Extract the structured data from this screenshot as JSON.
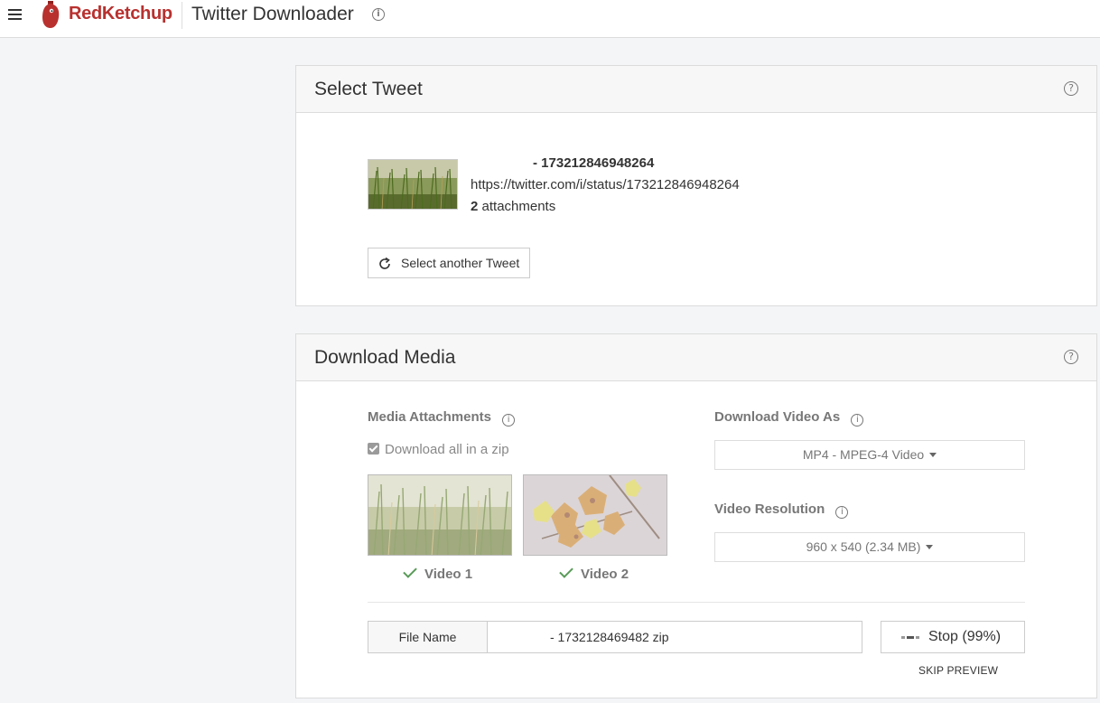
{
  "app": {
    "brand": "RedKetchup",
    "title": "Twitter Downloader",
    "title_info_icon": "info-icon",
    "brand_color": "#b8312f"
  },
  "select_tweet": {
    "title": "Select Tweet",
    "help_icon": "help-icon",
    "tweet_id": "- 173212846948264",
    "tweet_url": "https://twitter.com/i/status/173212846948264",
    "attachment_count": "2",
    "attachment_label": "attachments",
    "select_another_label": "Select another Tweet"
  },
  "download_media": {
    "title": "Download Media",
    "help_icon": "help-icon",
    "media_attachments_label": "Media Attachments",
    "download_zip_label": "Download all in a zip",
    "download_zip_checked": true,
    "videos": [
      {
        "label": "Video 1",
        "selected": true
      },
      {
        "label": "Video 2",
        "selected": true
      }
    ],
    "download_as_label": "Download Video As",
    "download_as_value": "MP4 - MPEG-4 Video",
    "resolution_label": "Video Resolution",
    "resolution_value": "960 x 540 (2.34 MB)",
    "file_name_label": "File Name",
    "file_name_value": "- 1732128469482  zip",
    "stop_label": "Stop (99%)",
    "progress_percent": 99,
    "skip_preview_label": "SKIP PREVIEW"
  }
}
